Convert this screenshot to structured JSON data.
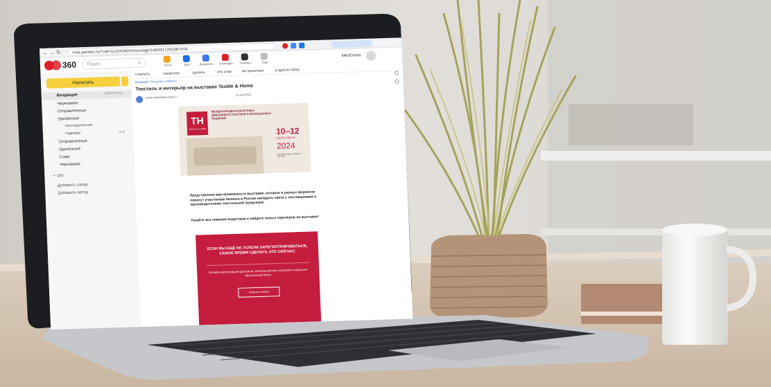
{
  "colors": {
    "brand_red": "#e0212a",
    "compose_yellow": "#f6cf3c",
    "banner_crimson": "#c41d3d",
    "wall": "#d9d6d2",
    "laptop_silver": "#c9cacd",
    "desk": "#d8cabb",
    "mug": "#f3f3f1"
  },
  "browser": {
    "url": "mail.yandex.ru/?uid=11304380#/message/1883917281987459"
  },
  "mail_app": {
    "logo_text": "360",
    "search_placeholder": "Поиск",
    "account_name": "MedGross",
    "top_services": [
      "Почта",
      "Диск",
      "Документы",
      "Календарь",
      "Телемост",
      "Ещё"
    ],
    "compose_label": "Написать",
    "folders": [
      {
        "name": "Входящие",
        "count": "1 ВСЕ ПОЧТЫ",
        "icon": "inbox-icon",
        "active": true
      },
      {
        "name": "Черновики",
        "count": "",
        "icon": "draft-icon",
        "active": false
      },
      {
        "name": "Отправленные",
        "count": "",
        "icon": "sent-icon",
        "active": false
      },
      {
        "name": "Удалённые",
        "count": "",
        "icon": "trash-icon",
        "active": false
      },
      {
        "name": "Неотправленные",
        "count": "",
        "icon": "",
        "active": false
      },
      {
        "name": "Подписки",
        "count": "273",
        "icon": "",
        "active": false
      },
      {
        "name": "Отправленные",
        "count": "",
        "icon": "sent-icon",
        "active": false
      },
      {
        "name": "Удалённые",
        "count": "",
        "icon": "trash-icon",
        "active": false
      },
      {
        "name": "Спам",
        "count": "",
        "icon": "spam-icon",
        "active": false
      },
      {
        "name": "Черновики",
        "count": "",
        "icon": "draft-icon",
        "active": false
      }
    ],
    "sidebar_footer": [
      "+ 100"
    ],
    "sidebar_extras": [
      "Добавить папку",
      "Добавить метку"
    ],
    "toolbar_items": [
      "Ответить",
      "Переслать",
      "Удалить",
      "Это спам",
      "Не прочитано",
      "В другую папку"
    ],
    "breadcrumb": "Входящие › Рассылки › Новости",
    "subject": "Текстиль и интерьер на выставке Textile & Home",
    "sender": "textile-home@ite-expo.ru",
    "date": "11 ноя 2024",
    "email": {
      "banner_heading": "МЕЖДУНАРОДНАЯ ВЫСТАВКА ДОМАШНЕГО ТЕКСТИЛЯ И ИНТЕРЬЕРНЫХ РЕШЕНИЙ",
      "brand_logo_letters": "TH",
      "brand_logo_caption": "TEXTILE & HOME",
      "dates_line": "10–12",
      "month_line": "СЕНТЯБРЯ",
      "year_line": "2024",
      "venue_line": "МОСКВА МВЦ «КРОКУС ЭКСПО»",
      "intro_text": "Представляем вам возможности выставки, которые в разных форматах помогут участникам бизнеса в России наладить связи с поставщиками и производителями текстильной продукции.",
      "intro_text_2": "Узнайте все новинки индустрии и найдите новых партнёров на выставке!",
      "cta_heading": "ЕСЛИ ВЫ ЕЩЁ НЕ УСПЕЛИ ЗАРЕГИСТРИРОВАТЬСЯ, САМОЕ ВРЕМЯ СДЕЛАТЬ ЭТО СЕЙЧАС!",
      "cta_text": "Онлайн-регистрация доступна, воспользуйтесь ссылкой и получите бесплатный билет",
      "cta_button": "Получить билет"
    }
  }
}
